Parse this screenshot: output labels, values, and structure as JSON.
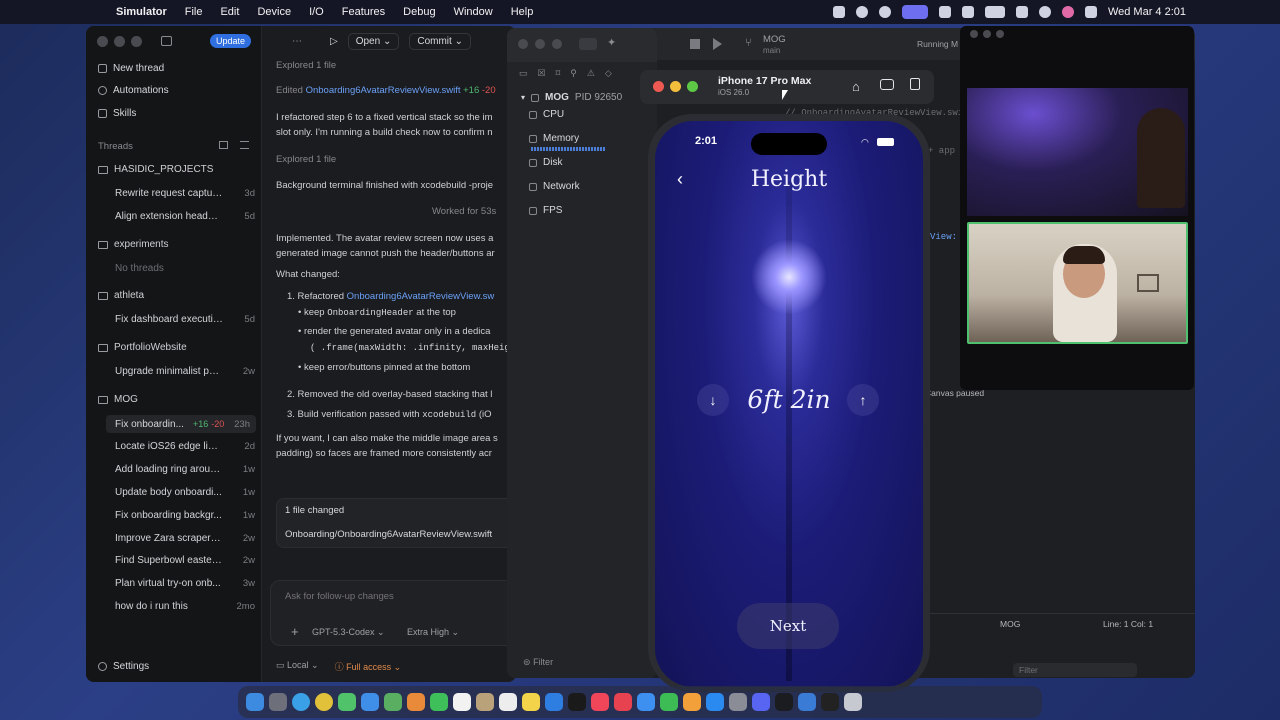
{
  "menubar": {
    "app": "Simulator",
    "items": [
      "File",
      "Edit",
      "Device",
      "I/O",
      "Features",
      "Debug",
      "Window",
      "Help"
    ],
    "clock": "Wed Mar 4  2:01"
  },
  "codex": {
    "update_label": "Update",
    "nav": {
      "new_thread": "New thread",
      "automations": "Automations",
      "skills": "Skills"
    },
    "threads_heading": "Threads",
    "groups": [
      {
        "name": "HASIDIC_PROJECTS",
        "threads": [
          {
            "title": "Rewrite request captur...",
            "age": "3d"
          },
          {
            "title": "Align extension header...",
            "age": "5d"
          }
        ]
      },
      {
        "name": "experiments",
        "empty": "No threads"
      },
      {
        "name": "athleta",
        "threads": [
          {
            "title": "Fix dashboard executio...",
            "age": "5d"
          }
        ]
      },
      {
        "name": "PortfolioWebsite",
        "threads": [
          {
            "title": "Upgrade minimalist por...",
            "age": "2w"
          }
        ]
      },
      {
        "name": "MOG",
        "threads": [
          {
            "title": "Fix onboardin...",
            "plus": "+16",
            "minus": "-20",
            "age": "23h"
          },
          {
            "title": "Locate iOS26 edge ligh...",
            "age": "2d"
          },
          {
            "title": "Add loading ring aroun...",
            "age": "1w"
          },
          {
            "title": "Update body onboardi...",
            "age": "1w"
          },
          {
            "title": "Fix onboarding backgr...",
            "age": "1w"
          },
          {
            "title": "Improve Zara scraper s...",
            "age": "2w"
          },
          {
            "title": "Find Superbowl easter ...",
            "age": "2w"
          },
          {
            "title": "Plan virtual try-on onb...",
            "age": "3w"
          },
          {
            "title": "how do i run this",
            "age": "2mo"
          }
        ]
      }
    ],
    "settings": "Settings",
    "toolbar": {
      "open": "Open",
      "commit": "Commit"
    },
    "main": {
      "explored1": "Explored 1 file",
      "edited_prefix": "Edited ",
      "edited_file": "Onboarding6AvatarReviewView.swift",
      "edited_plus": "+16",
      "edited_minus": "-20",
      "para1_l1": "I refactored step 6 to a fixed vertical stack so the im",
      "para1_l2": "slot only. I'm running a build check now to confirm n",
      "explored2": "Explored 1 file",
      "bg_terminal": "Background terminal finished with xcodebuild -proje",
      "worked": "Worked for 53s",
      "impl_l1": "Implemented. The avatar review screen now uses a",
      "impl_l2": "generated image cannot push the header/buttons ar",
      "what_changed": "What changed:",
      "li1_prefix": "1. Refactored ",
      "li1_link": "Onboarding6AvatarReviewView.sw",
      "sub1_pre": "keep ",
      "sub1_code": "OnboardingHeader",
      "sub1_post": " at the top",
      "sub2": "render the generated avatar only in a dedica",
      "sub2_code": "( .frame(maxWidth: .infinity, maxHeig",
      "sub3": "keep error/buttons pinned at the bottom",
      "li2": "2. Removed the old overlay-based stacking that l",
      "li3_pre": "3. Build verification passed with ",
      "li3_code": "xcodebuild",
      "li3_post": " (iO",
      "tail_l1": "If you want, I can also make the middle image area s",
      "tail_l2": "padding) so faces are framed more consistently acr",
      "files_changed": "1 file changed",
      "changed_path": "Onboarding/Onboarding6AvatarReviewView.swift",
      "composer_placeholder": "Ask for follow-up changes",
      "model": "GPT-5.3-Codex",
      "effort": "Extra High",
      "env": "Local",
      "access": "Full access"
    }
  },
  "instruments": {
    "process": "MOG",
    "pid": "PID 92650",
    "gauges": [
      "CPU",
      "Memory",
      "Disk",
      "Network",
      "FPS"
    ],
    "filter": "Filter"
  },
  "xcode": {
    "scheme": "MOG",
    "branch": "main",
    "running": "Running M",
    "code_l1": "// OnboardingAvatarReviewView.swi",
    "code_l2": "+ app",
    "code_l3": "View:",
    "canvas": "Canvas paused",
    "status_scheme": "MOG",
    "line_col": "Line: 1  Col: 1",
    "filter": "Filter"
  },
  "simulator": {
    "device": "iPhone 17 Pro Max",
    "os": "iOS 26.0",
    "time": "2:01",
    "screen_title": "Height",
    "height_value": "6ft 2in",
    "next_label": "Next"
  }
}
